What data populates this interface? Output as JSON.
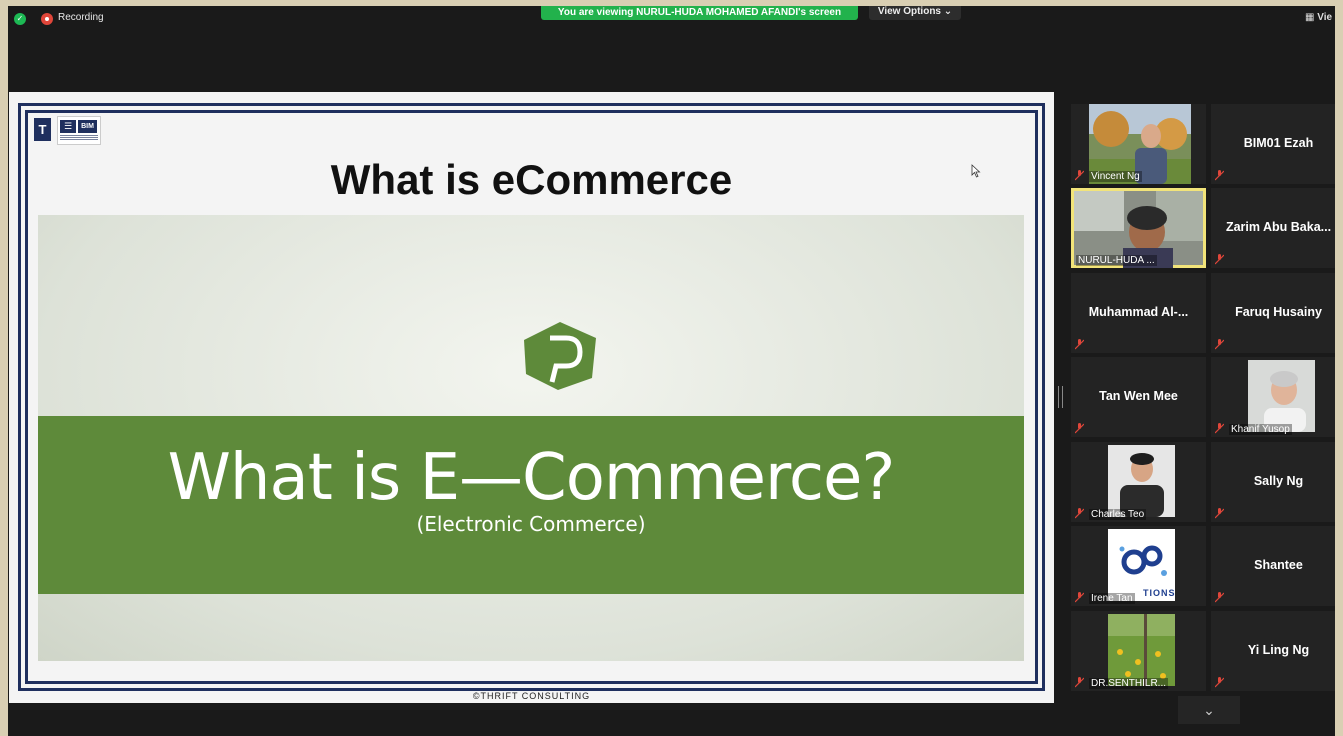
{
  "topbar": {
    "recording_label": "Recording",
    "viewing_banner": "You are viewing NURUL-HUDA MOHAMED AFANDI's screen",
    "view_options_label": "View Options ⌄",
    "gallery_view_label": "Vie"
  },
  "slide": {
    "title": "What is eCommerce",
    "video_title": "What is E—Commerce?",
    "video_subtitle": "(Electronic Commerce)",
    "footer": "©THRIFT CONSULTING",
    "logo_left_text": "T",
    "logo_right_text": "BIM"
  },
  "participants": [
    {
      "name": "Vincent Ng"
    },
    {
      "name": "BIM01 Ezah"
    },
    {
      "name": "NURUL-HUDA ..."
    },
    {
      "name": "Zarim Abu Baka..."
    },
    {
      "name": "Muhammad Al-..."
    },
    {
      "name": "Faruq Husainy"
    },
    {
      "name": "Tan Wen Mee"
    },
    {
      "name": "Khanif Yusop"
    },
    {
      "name": "Charles Teo"
    },
    {
      "name": "Sally Ng"
    },
    {
      "name": "Irene Tan"
    },
    {
      "name": "Shantee"
    },
    {
      "name": "DR.SENTHILR..."
    },
    {
      "name": "Yi Ling Ng"
    }
  ],
  "photo_texts": {
    "irene_logo": "TIONS"
  },
  "gallery_scroll_icon": "chevron-down-icon",
  "colors": {
    "viewing_banner": "#22b24c",
    "active_speaker_outline": "#f2e47a",
    "muted_mic": "#e0463a",
    "slide_frame": "#1f2f5e",
    "video_band": "#5e8a3a"
  }
}
